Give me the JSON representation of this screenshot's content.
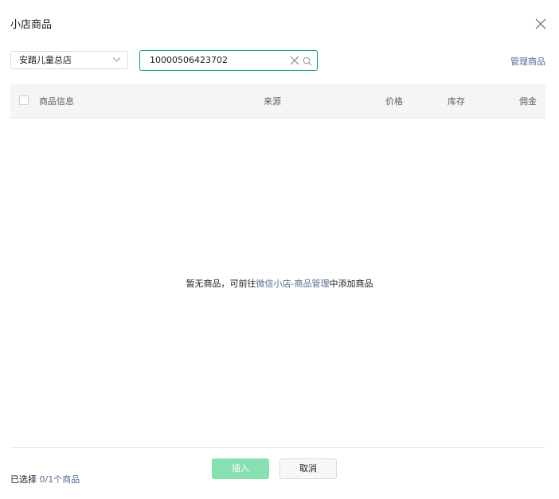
{
  "dialog": {
    "title": "小店商品"
  },
  "filters": {
    "store_select_value": "安踏儿童总店",
    "search_value": "10000506423702",
    "manage_link": "管理商品"
  },
  "table": {
    "columns": [
      "商品信息",
      "来源",
      "价格",
      "库存",
      "佣金"
    ]
  },
  "empty_state": {
    "prefix": "暂无商品，可前往",
    "link": "微信小店-商品管理",
    "suffix": "中添加商品"
  },
  "footer": {
    "selected_prefix": "已选择",
    "selected_count": "0/1个商品",
    "insert_label": "插入",
    "cancel_label": "取消"
  },
  "colors": {
    "accent": "#07a35a",
    "link": "#576b95",
    "insert_disabled": "#86e0b0"
  }
}
